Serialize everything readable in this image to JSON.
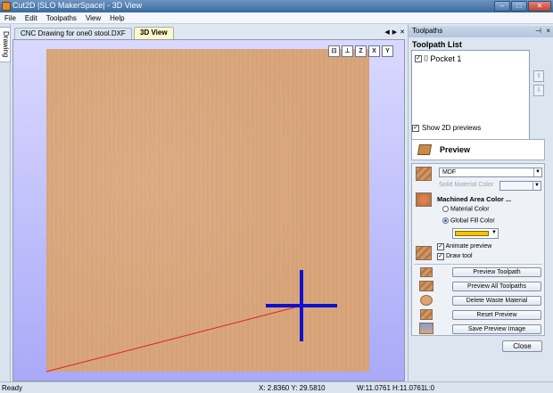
{
  "window": {
    "title": "Cut2D |SLO MakerSpace| - 3D View"
  },
  "menu": [
    "File",
    "Edit",
    "Toolpaths",
    "View",
    "Help"
  ],
  "left_dock": {
    "tab_label": "Drawing"
  },
  "doc_tabs": [
    {
      "label": "CNC Drawing for one0 stool.DXF",
      "active": false
    },
    {
      "label": "3D View",
      "active": true
    }
  ],
  "view_toolbar": [
    "iso-view-icon",
    "top-view-icon",
    "z-view-icon",
    "x-view-icon",
    "y-view-icon"
  ],
  "view_toolbar_labels": {
    "z": "Z",
    "x": "X",
    "y": "Y"
  },
  "panel": {
    "title": "Toolpaths",
    "pin_glyph": "⊣",
    "close_glyph": "×",
    "toolpath_list_title": "Toolpath List",
    "toolpaths": [
      {
        "label": "Pocket 1",
        "checked": true
      }
    ],
    "show_2d_previews_label": "Show 2D previews",
    "show_2d_previews_checked": true,
    "preview": {
      "title": "Preview",
      "material_selected": "MDF",
      "solid_material_color_label": "Solid Material Color",
      "machined_area_color_label": "Machined Area Color ...",
      "material_color_label": "Material Color",
      "global_fill_color_label": "Global Fill Color",
      "fill_color": "#f4c400",
      "animate_preview_label": "Animate preview",
      "animate_preview_checked": true,
      "draw_tool_label": "Draw tool",
      "draw_tool_checked": true,
      "buttons": {
        "preview_toolpath": "Preview Toolpath",
        "preview_all": "Preview All Toolpaths",
        "delete_waste": "Delete Waste Material",
        "reset_preview": "Reset Preview",
        "save_preview_image": "Save Preview Image"
      },
      "close_label": "Close"
    }
  },
  "status": {
    "left": "Ready",
    "x": "X:  2.8360 Y: 29.5810",
    "w": "W:11.0761",
    "h": "H:11.0761",
    "l": "L:0"
  },
  "colors": {
    "board": "#d9a67c",
    "tool": "#1010d0",
    "path": "#e02020"
  }
}
